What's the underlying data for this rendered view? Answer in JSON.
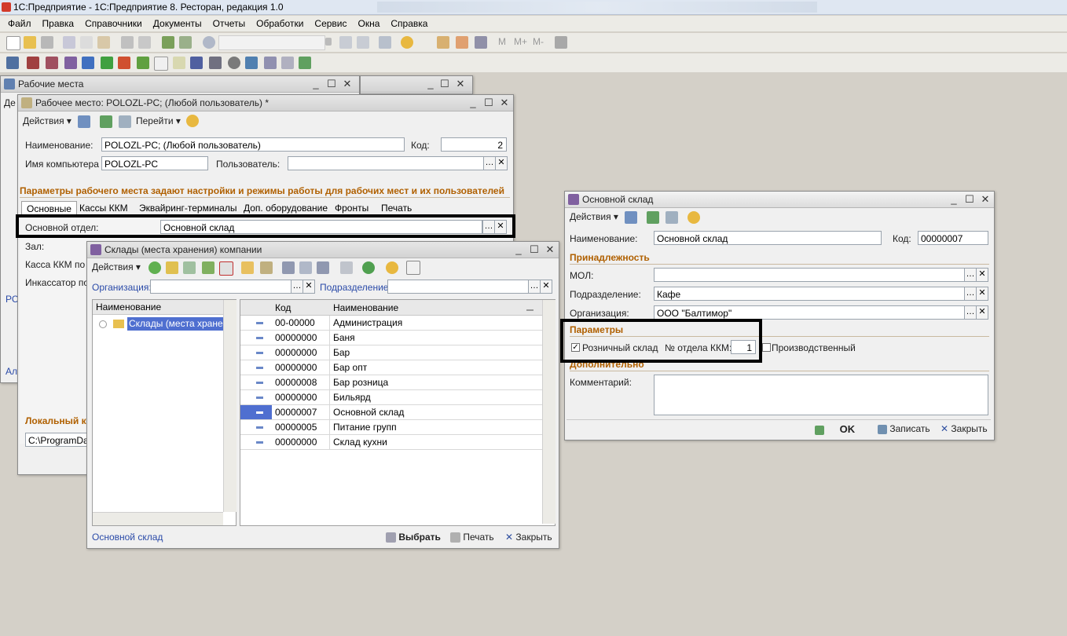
{
  "app": {
    "title": "1С:Предприятие - 1С:Предприятие 8. Ресторан, редакция 1.0"
  },
  "menu": [
    "Файл",
    "Правка",
    "Справочники",
    "Документы",
    "Отчеты",
    "Обработки",
    "Сервис",
    "Окна",
    "Справка"
  ],
  "toolbar": {
    "m_labels": [
      "M",
      "M+",
      "M-"
    ]
  },
  "win_workplaces": {
    "title": "Рабочие места",
    "bg_fragments": [
      "Де",
      "РС",
      "Ал"
    ]
  },
  "win_workplace": {
    "title": "Рабочее место: POLOZL-PC; (Любой пользователь) *",
    "actions": "Действия",
    "goto": "Перейти",
    "name_label": "Наименование:",
    "name_value": "POLOZL-PC; (Любой пользователь)",
    "code_label": "Код:",
    "code_value": "2",
    "computer_label": "Имя компьютера",
    "computer_value": "POLOZL-PC",
    "user_label": "Пользователь:",
    "user_value": "",
    "section_params": "Параметры рабочего места задают настройки и режимы работы для рабочих мест и их пользователей",
    "tabs": [
      "Основные",
      "Кассы ККМ",
      "Эквайринг-терминалы",
      "Доп. оборудование",
      "Фронты",
      "Печать"
    ],
    "dept_label": "Основной отдел:",
    "dept_value": "Основной склад",
    "hall_label": "Зал:",
    "kkm_label": "Касса ККМ по у",
    "collector_label": "Инкассатор по",
    "local_label": "Локальный к",
    "path_value": "C:\\ProgramData"
  },
  "win_warehouses": {
    "title": "Склады (места хранения) компании",
    "actions": "Действия",
    "org_label": "Организация:",
    "org_value": "",
    "dept_label": "Подразделение:",
    "dept_value": "",
    "tree_header": "Наименование",
    "tree_root": "Склады (места хранения)",
    "col_code": "Код",
    "col_name": "Наименование",
    "rows": [
      {
        "code": "00-00000",
        "name": "Администрация"
      },
      {
        "code": "00000000",
        "name": "Баня"
      },
      {
        "code": "00000000",
        "name": "Бар"
      },
      {
        "code": "00000000",
        "name": "Бар опт"
      },
      {
        "code": "00000008",
        "name": "Бар розница"
      },
      {
        "code": "00000000",
        "name": "Бильярд"
      },
      {
        "code": "00000007",
        "name": "Основной склад"
      },
      {
        "code": "00000005",
        "name": "Питание групп"
      },
      {
        "code": "00000000",
        "name": "Склад кухни"
      }
    ],
    "selected_index": 6,
    "status_text": "Основной склад",
    "select_btn": "Выбрать",
    "print_btn": "Печать",
    "close_btn": "Закрыть"
  },
  "win_main_wh": {
    "title": "Основной склад",
    "actions": "Действия",
    "name_label": "Наименование:",
    "name_value": "Основной склад",
    "code_label": "Код:",
    "code_value": "00000007",
    "section_belong": "Принадлежность",
    "mol_label": "МОЛ:",
    "mol_value": "",
    "dept_label": "Подразделение:",
    "dept_value": "Кафе",
    "org_label": "Организация:",
    "org_value": "ООО \"Балтимор\"",
    "section_params": "Параметры",
    "retail_label": "Розничный склад",
    "retail_checked": true,
    "kkm_dept_label": "№ отдела ККМ:",
    "kkm_dept_value": "1",
    "production_label": "Производственный",
    "production_checked": false,
    "section_extra": "Дополнительно",
    "comment_label": "Комментарий:",
    "comment_value": "",
    "ok_btn": "OK",
    "save_btn": "Записать",
    "close_btn": "Закрыть"
  }
}
